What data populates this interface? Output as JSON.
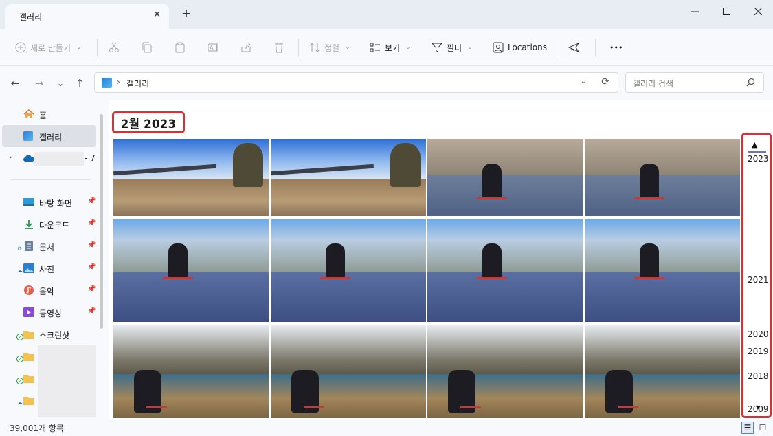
{
  "window": {
    "tab_title": "갤러리",
    "tab_close": "✕",
    "new_tab": "+",
    "minimize": "—",
    "maximize": "☐",
    "close": "✕"
  },
  "toolbar": {
    "new": "새로 만들기",
    "sort": "정렬",
    "view": "보기",
    "filter": "필터",
    "locations": "Locations",
    "more": "•••"
  },
  "address_bar": {
    "separator": "›",
    "path": "갤러리",
    "search_placeholder": "갤러리 검색"
  },
  "sidebar": {
    "home": "홈",
    "gallery": "갤러리",
    "onedrive_suffix": "- 7",
    "quick_access": [
      {
        "label": "바탕 화면",
        "icon": "desktop-icon"
      },
      {
        "label": "다운로드",
        "icon": "download-icon"
      },
      {
        "label": "문서",
        "icon": "documents-icon"
      },
      {
        "label": "사진",
        "icon": "pictures-icon"
      },
      {
        "label": "음악",
        "icon": "music-icon"
      },
      {
        "label": "동영상",
        "icon": "videos-icon"
      },
      {
        "label": "스크린샷",
        "icon": "folder-icon"
      }
    ]
  },
  "content": {
    "month_heading": "2월 2023",
    "photos": [
      {
        "scene": "park-path-blue-sky"
      },
      {
        "scene": "park-path-blue-sky"
      },
      {
        "scene": "child-bike-road"
      },
      {
        "scene": "child-bike-road"
      },
      {
        "scene": "child-bike-building"
      },
      {
        "scene": "child-bike-building"
      },
      {
        "scene": "child-bike-building"
      },
      {
        "scene": "child-bike-building"
      },
      {
        "scene": "child-pond-trees"
      },
      {
        "scene": "child-pond-trees"
      },
      {
        "scene": "child-pond-trees"
      },
      {
        "scene": "child-pond-trees"
      }
    ]
  },
  "timeline": {
    "up": "▲",
    "down": "▼",
    "years": [
      "2023",
      "2021",
      "2020",
      "2019",
      "2018",
      "2009"
    ]
  },
  "status": {
    "item_count": "39,001개 항목"
  },
  "colors": {
    "highlight": "#d13438",
    "accent": "#0067c0"
  }
}
